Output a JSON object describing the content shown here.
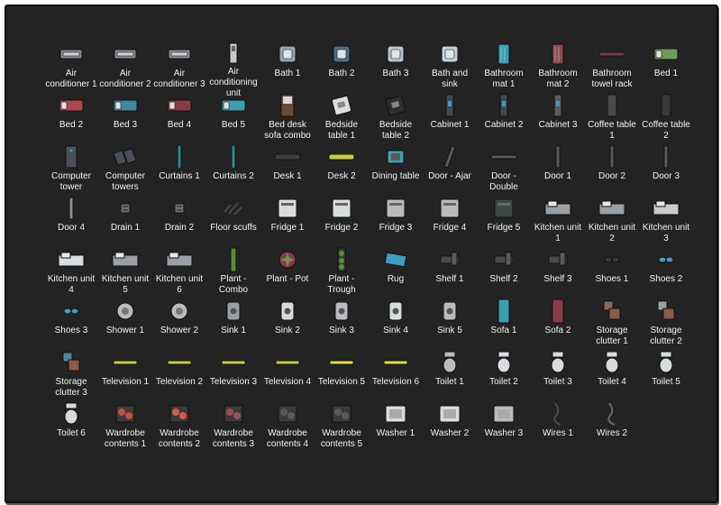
{
  "assets": [
    {
      "label": "Air conditioner 1",
      "icon": "air-conditioner-icon",
      "color": "#8a9096"
    },
    {
      "label": "Air conditioner 2",
      "icon": "air-conditioner-icon",
      "color": "#8a9096"
    },
    {
      "label": "Air conditioner 3",
      "icon": "air-conditioner-icon",
      "color": "#8a9096"
    },
    {
      "label": "Air conditioning unit",
      "icon": "ac-unit-icon",
      "color": "#c7cacd"
    },
    {
      "label": "Bath 1",
      "icon": "bath-icon",
      "color": "#9aa3aa"
    },
    {
      "label": "Bath 2",
      "icon": "bath-icon",
      "color": "#4a6f85"
    },
    {
      "label": "Bath 3",
      "icon": "bath-icon",
      "color": "#b9c4cc"
    },
    {
      "label": "Bath and sink",
      "icon": "bath-sink-icon",
      "color": "#c8d0d6"
    },
    {
      "label": "Bathroom mat 1",
      "icon": "bathroom-mat-icon",
      "color": "#3a9fb3"
    },
    {
      "label": "Bathroom mat 2",
      "icon": "bathroom-mat-icon",
      "color": "#8c4a55"
    },
    {
      "label": "Bathroom towel rack",
      "icon": "towel-rack-icon",
      "color": "#7a3b48"
    },
    {
      "label": "Bed 1",
      "icon": "bed-icon",
      "color": "#6e9a5a"
    },
    {
      "label": "Bed 2",
      "icon": "bed-icon",
      "color": "#b0454f"
    },
    {
      "label": "Bed 3",
      "icon": "bed-icon",
      "color": "#3f8aa0"
    },
    {
      "label": "Bed 4",
      "icon": "bed-icon",
      "color": "#8b3a44"
    },
    {
      "label": "Bed 5",
      "icon": "bed-icon",
      "color": "#3aa0b0"
    },
    {
      "label": "Bed desk sofa combo",
      "icon": "combo-icon",
      "color": "#6a4a3a"
    },
    {
      "label": "Bedside table 1",
      "icon": "bedside-table-icon",
      "color": "#dcdcdc"
    },
    {
      "label": "Bedside table 2",
      "icon": "bedside-table-icon",
      "color": "#2e2e2e"
    },
    {
      "label": "Cabinet 1",
      "icon": "cabinet-icon",
      "color": "#3e4a52"
    },
    {
      "label": "Cabinet 2",
      "icon": "cabinet-icon",
      "color": "#3e4a52"
    },
    {
      "label": "Cabinet 3",
      "icon": "cabinet-icon",
      "color": "#5a5a5a"
    },
    {
      "label": "Coffee table 1",
      "icon": "coffee-table-icon",
      "color": "#4a4a4a"
    },
    {
      "label": "Coffee table 2",
      "icon": "coffee-table-icon",
      "color": "#3a3a3a"
    },
    {
      "label": "Computer tower",
      "icon": "computer-tower-icon",
      "color": "#4a5058"
    },
    {
      "label": "Computer towers",
      "icon": "computer-towers-icon",
      "color": "#4a5058"
    },
    {
      "label": "Curtains 1",
      "icon": "curtains-icon",
      "color": "#2d8a8c"
    },
    {
      "label": "Curtains 2",
      "icon": "curtains-icon",
      "color": "#2d8a8c"
    },
    {
      "label": "Desk 1",
      "icon": "desk-icon",
      "color": "#3a3f44"
    },
    {
      "label": "Desk 2",
      "icon": "desk-icon",
      "color": "#c8d038"
    },
    {
      "label": "Dining table",
      "icon": "dining-table-icon",
      "color": "#3aa0b0"
    },
    {
      "label": "Door - Ajar",
      "icon": "door-ajar-icon",
      "color": "#555a5f"
    },
    {
      "label": "Door - Double",
      "icon": "door-double-icon",
      "color": "#555a5f"
    },
    {
      "label": "Door 1",
      "icon": "door-icon",
      "color": "#555a5f"
    },
    {
      "label": "Door 2",
      "icon": "door-icon",
      "color": "#555a5f"
    },
    {
      "label": "Door 3",
      "icon": "door-icon",
      "color": "#555a5f"
    },
    {
      "label": "Door 4",
      "icon": "door-icon",
      "color": "#8a8f94"
    },
    {
      "label": "Drain 1",
      "icon": "drain-icon",
      "color": "#6a7076"
    },
    {
      "label": "Drain 2",
      "icon": "drain-icon",
      "color": "#6a7076"
    },
    {
      "label": "Floor scuffs",
      "icon": "floor-scuffs-icon",
      "color": "#3a3a3a"
    },
    {
      "label": "Fridge 1",
      "icon": "fridge-icon",
      "color": "#d8dcdf"
    },
    {
      "label": "Fridge 2",
      "icon": "fridge-icon",
      "color": "#d8dcdf"
    },
    {
      "label": "Fridge 3",
      "icon": "fridge-icon",
      "color": "#b8bcbf"
    },
    {
      "label": "Fridge 4",
      "icon": "fridge-icon",
      "color": "#b8bcbf"
    },
    {
      "label": "Fridge 5",
      "icon": "fridge-icon",
      "color": "#3a4a44"
    },
    {
      "label": "Kitchen unit 1",
      "icon": "kitchen-unit-icon",
      "color": "#9aa0a6"
    },
    {
      "label": "Kitchen unit 2",
      "icon": "kitchen-unit-icon",
      "color": "#9aa0a6"
    },
    {
      "label": "Kitchen unit 3",
      "icon": "kitchen-unit-icon",
      "color": "#c8cccf"
    },
    {
      "label": "Kitchen unit 4",
      "icon": "kitchen-unit-icon",
      "color": "#d8dcdf"
    },
    {
      "label": "Kitchen unit 5",
      "icon": "kitchen-unit-icon",
      "color": "#9aa0a6"
    },
    {
      "label": "Kitchen unit 6",
      "icon": "kitchen-unit-icon",
      "color": "#9aa0a6"
    },
    {
      "label": "Plant - Combo",
      "icon": "plant-icon",
      "color": "#5a8a3a"
    },
    {
      "label": "Plant - Pot",
      "icon": "plant-pot-icon",
      "color": "#8a3a4a"
    },
    {
      "label": "Plant - Trough",
      "icon": "plant-trough-icon",
      "color": "#5a8a3a"
    },
    {
      "label": "Rug",
      "icon": "rug-icon",
      "color": "#3aa0c0"
    },
    {
      "label": "Shelf 1",
      "icon": "shelf-icon",
      "color": "#4a4a4a"
    },
    {
      "label": "Shelf 2",
      "icon": "shelf-icon",
      "color": "#4a4a4a"
    },
    {
      "label": "Shelf 3",
      "icon": "shelf-icon",
      "color": "#4a4a4a"
    },
    {
      "label": "Shoes 1",
      "icon": "shoes-icon",
      "color": "#3a3a3a"
    },
    {
      "label": "Shoes 2",
      "icon": "shoes-icon",
      "color": "#3aa0c0"
    },
    {
      "label": "Shoes 3",
      "icon": "shoes-icon",
      "color": "#3aa0c0"
    },
    {
      "label": "Shower 1",
      "icon": "shower-icon",
      "color": "#b8bcbf"
    },
    {
      "label": "Shower 2",
      "icon": "shower-icon",
      "color": "#b8bcbf"
    },
    {
      "label": "Sink 1",
      "icon": "sink-icon",
      "color": "#9aa0a6"
    },
    {
      "label": "Sink 2",
      "icon": "sink-icon",
      "color": "#d8dcdf"
    },
    {
      "label": "Sink 3",
      "icon": "sink-icon",
      "color": "#b8bcbf"
    },
    {
      "label": "Sink 4",
      "icon": "sink-icon",
      "color": "#d8dcdf"
    },
    {
      "label": "Sink 5",
      "icon": "sink-icon",
      "color": "#b8bcbf"
    },
    {
      "label": "Sofa 1",
      "icon": "sofa-icon",
      "color": "#3aa0b0"
    },
    {
      "label": "Sofa 2",
      "icon": "sofa-icon",
      "color": "#8a3a4a"
    },
    {
      "label": "Storage clutter 1",
      "icon": "storage-clutter-icon",
      "color": "#8a6a5a"
    },
    {
      "label": "Storage clutter 2",
      "icon": "storage-clutter-icon",
      "color": "#9aa0a6"
    },
    {
      "label": "Storage clutter 3",
      "icon": "storage-clutter-icon",
      "color": "#4a8aa0"
    },
    {
      "label": "Television 1",
      "icon": "television-icon",
      "color": "#c8d038"
    },
    {
      "label": "Television 2",
      "icon": "television-icon",
      "color": "#c8d038"
    },
    {
      "label": "Television 3",
      "icon": "television-icon",
      "color": "#c8d038"
    },
    {
      "label": "Television 4",
      "icon": "television-icon",
      "color": "#c8d038"
    },
    {
      "label": "Television 5",
      "icon": "television-icon",
      "color": "#e0e030"
    },
    {
      "label": "Television 6",
      "icon": "television-icon",
      "color": "#e0e030"
    },
    {
      "label": "Toilet 1",
      "icon": "toilet-icon",
      "color": "#b8bcbf"
    },
    {
      "label": "Toilet 2",
      "icon": "toilet-icon",
      "color": "#d8dcdf"
    },
    {
      "label": "Toilet 3",
      "icon": "toilet-icon",
      "color": "#d8dcdf"
    },
    {
      "label": "Toilet 4",
      "icon": "toilet-icon",
      "color": "#d8dcdf"
    },
    {
      "label": "Toilet 5",
      "icon": "toilet-icon",
      "color": "#d8dcdf"
    },
    {
      "label": "Toilet 6",
      "icon": "toilet-icon",
      "color": "#d8dcdf"
    },
    {
      "label": "Wardrobe contents 1",
      "icon": "wardrobe-contents-icon",
      "color": "#c05040"
    },
    {
      "label": "Wardrobe contents 2",
      "icon": "wardrobe-contents-icon",
      "color": "#d06040"
    },
    {
      "label": "Wardrobe contents 3",
      "icon": "wardrobe-contents-icon",
      "color": "#a04a5a"
    },
    {
      "label": "Wardrobe contents 4",
      "icon": "wardrobe-contents-icon",
      "color": "#5a5a5a"
    },
    {
      "label": "Wardrobe contents 5",
      "icon": "wardrobe-contents-icon",
      "color": "#5a5a5a"
    },
    {
      "label": "Washer 1",
      "icon": "washer-icon",
      "color": "#d8dcdf"
    },
    {
      "label": "Washer 2",
      "icon": "washer-icon",
      "color": "#d8dcdf"
    },
    {
      "label": "Washer 3",
      "icon": "washer-icon",
      "color": "#b8bcbf"
    },
    {
      "label": "Wires 1",
      "icon": "wires-icon",
      "color": "#4a4a4a"
    },
    {
      "label": "Wires 2",
      "icon": "wires-icon",
      "color": "#6a6a6a"
    }
  ]
}
